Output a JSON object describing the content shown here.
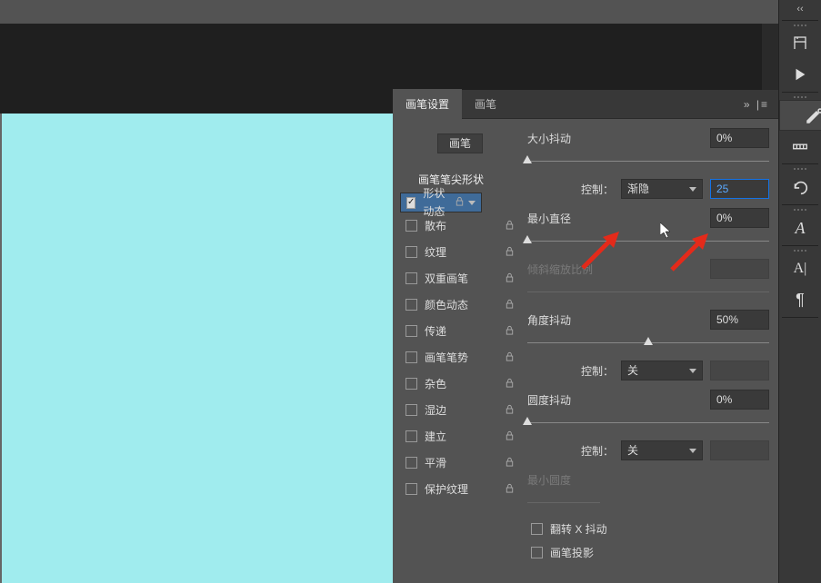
{
  "tabs": {
    "settings": "画笔设置",
    "brush": "画笔",
    "expander": "»  |≡"
  },
  "leftcol": {
    "brush_btn": "画笔",
    "tip_shape": "画笔笔尖形状",
    "options": [
      {
        "label": "形状动态",
        "checked": true,
        "selected": true
      },
      {
        "label": "散布",
        "checked": false
      },
      {
        "label": "纹理",
        "checked": false
      },
      {
        "label": "双重画笔",
        "checked": false
      },
      {
        "label": "颜色动态",
        "checked": false
      },
      {
        "label": "传递",
        "checked": false
      },
      {
        "label": "画笔笔势",
        "checked": false
      },
      {
        "label": "杂色",
        "checked": false
      },
      {
        "label": "湿边",
        "checked": false
      },
      {
        "label": "建立",
        "checked": false
      },
      {
        "label": "平滑",
        "checked": false
      },
      {
        "label": "保护纹理",
        "checked": false
      }
    ]
  },
  "rightcol": {
    "size_jitter": {
      "label": "大小抖动",
      "value": "0%"
    },
    "control1": {
      "label": "控制：",
      "select": "渐隐",
      "value": "25"
    },
    "min_diam": {
      "label": "最小直径",
      "value": "0%"
    },
    "tilt_scale": {
      "label": "倾斜缩放比例"
    },
    "angle_jitter": {
      "label": "角度抖动",
      "value": "50%"
    },
    "control2": {
      "label": "控制：",
      "select": "关"
    },
    "round_jitter": {
      "label": "圆度抖动",
      "value": "0%"
    },
    "control3": {
      "label": "控制：",
      "select": "关"
    },
    "min_round": {
      "label": "最小圆度"
    },
    "flipx": {
      "label": "翻转 X 抖动"
    },
    "proj": {
      "label": "画笔投影"
    }
  },
  "rail": {
    "chevrons": "‹‹"
  }
}
